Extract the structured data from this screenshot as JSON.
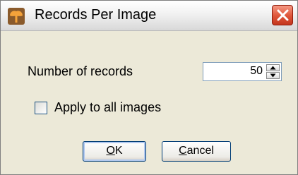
{
  "window": {
    "title": "Records Per Image"
  },
  "form": {
    "records_label": "Number of records",
    "records_value": "50",
    "apply_all_label": "Apply to all images",
    "apply_all_checked": false
  },
  "buttons": {
    "ok_mnemonic": "O",
    "ok_rest": "K",
    "cancel_mnemonic": "C",
    "cancel_rest": "ancel"
  },
  "icons": {
    "app": "tree-icon",
    "close": "close-icon",
    "up": "arrow-up-icon",
    "down": "arrow-down-icon"
  },
  "colors": {
    "close_button": "#d9482b",
    "title_bar": "#f1f1f1",
    "dialog_bg": "#ece9d8"
  }
}
